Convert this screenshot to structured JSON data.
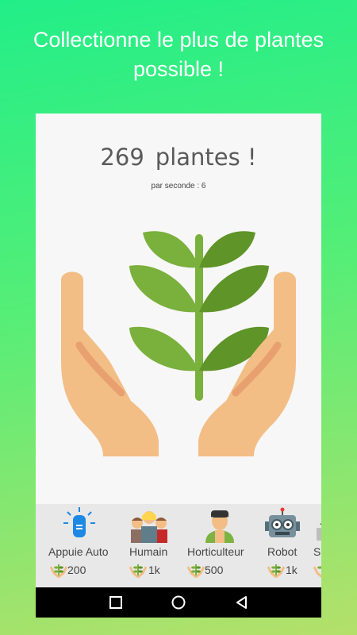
{
  "promo": {
    "line1": "Collectionne le plus de plantes",
    "line2": "possible !"
  },
  "counter": {
    "count": "269",
    "unit": "plantes !",
    "rate": "par seconde : 6"
  },
  "plant_button": {
    "icon": "hands-holding-plant-icon"
  },
  "shop": {
    "items": [
      {
        "name": "Appuie Auto",
        "cost": "200",
        "icon": "auto-tap-icon"
      },
      {
        "name": "Humain",
        "cost": "1k",
        "icon": "humans-icon"
      },
      {
        "name": "Horticulteur",
        "cost": "500",
        "icon": "gardener-icon"
      },
      {
        "name": "Robot",
        "cost": "1k",
        "icon": "robot-icon"
      },
      {
        "name": "S",
        "cost": "",
        "icon": "partial-item-icon"
      }
    ]
  },
  "navbar": {
    "back": "back-triangle-icon",
    "home": "home-circle-icon",
    "recents": "recents-square-icon"
  },
  "colors": {
    "background_top": "#22ee88",
    "background_bottom": "#b4e06a",
    "skin": "#f2be86",
    "skin_dark": "#e8a070",
    "leaf": "#7ab03c",
    "leaf_dark": "#5f9428"
  }
}
